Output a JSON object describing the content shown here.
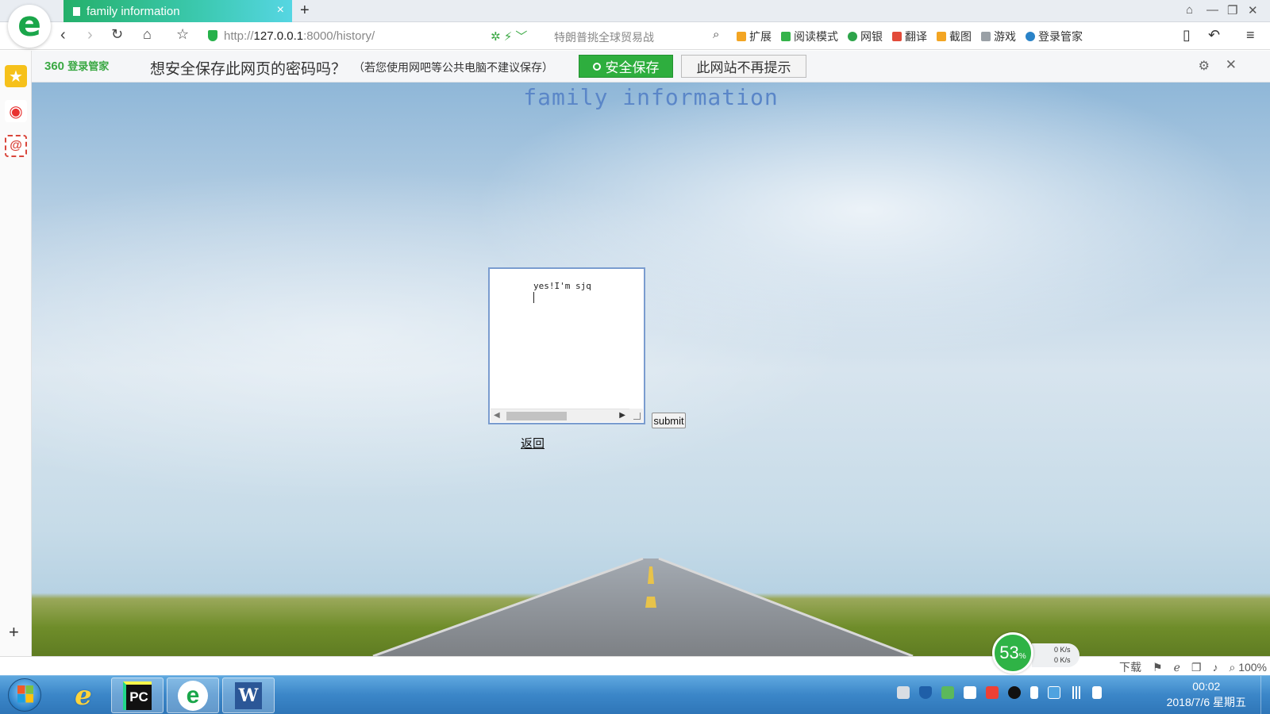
{
  "browser": {
    "tab_title": "family information",
    "new_tab": "+",
    "tab_close": "×",
    "url_scheme": "http://",
    "url_host": "127.0.0.1",
    "url_path": ":8000/history/",
    "search_hint": "特朗普挑全球贸易战",
    "toolbar": [
      "扩展",
      "阅读模式",
      "网银",
      "翻译",
      "截图",
      "游戏",
      "登录管家"
    ]
  },
  "password_bar": {
    "brand": "360",
    "brand_sub": "登录管家",
    "question": "想安全保存此网页的密码吗？",
    "note": "（若您使用网吧等公共电脑不建议保存）",
    "save_label": "安全保存",
    "never_label": "此网站不再提示"
  },
  "page": {
    "title": "family information",
    "textarea_value": "yes!I'm sjq",
    "submit_label": "submit",
    "back_label": "返回"
  },
  "status_bar": {
    "download": "下载",
    "zoom": "100%"
  },
  "network_widget": {
    "percent": "53",
    "percent_unit": "%",
    "upload": "0 K/s",
    "download": "0 K/s"
  },
  "taskbar": {
    "time": "00:02",
    "date": "2018/7/6 星期五"
  },
  "colors": {
    "tab_accent": "#3ec9d6",
    "save_green": "#2eae3e",
    "title_blue": "#5a86c8",
    "taskbar_blue": "#3b86c8"
  }
}
